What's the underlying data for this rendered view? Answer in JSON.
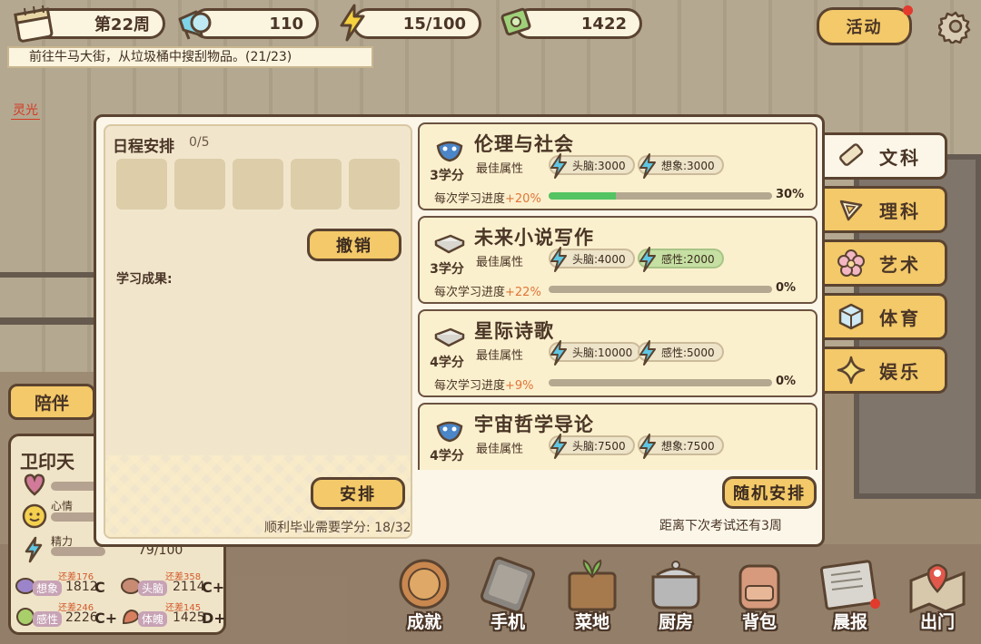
{
  "hud": {
    "week": "第22周",
    "announce_value": "110",
    "energy": "15/100",
    "money": "1422",
    "quest": "前往牛马大街，从垃圾桶中搜刮物品。(21/23)",
    "activity_label": "活动",
    "lingguang": "灵光"
  },
  "character": {
    "accompany_label": "陪伴",
    "name": "卫印天",
    "mood_label": "心情",
    "energy_label": "精力",
    "energy_value": "79/100",
    "attributes": [
      {
        "label": "想象",
        "value": "1812",
        "diff": "还差176",
        "grade": "C"
      },
      {
        "label": "头脑",
        "value": "2114",
        "diff": "还差358",
        "grade": "C+"
      },
      {
        "label": "感性",
        "value": "2226",
        "diff": "还差246",
        "grade": "C+"
      },
      {
        "label": "体魄",
        "value": "1425",
        "diff": "还差145",
        "grade": "D+"
      }
    ]
  },
  "schedule": {
    "title": "日程安排",
    "count": "0/5",
    "cancel_label": "撤销",
    "result_label": "学习成果:",
    "arrange_label": "安排",
    "credits_text": "顺利毕业需要学分: 18/32"
  },
  "courses": [
    {
      "name": "伦理与社会",
      "credit": "3学分",
      "best_label": "最佳属性",
      "attrs": [
        {
          "text": "头脑:3000",
          "met": false
        },
        {
          "text": "想象:3000",
          "met": false
        }
      ],
      "progress_prefix": "每次学习进度",
      "progress_gain": "+20%",
      "progress_value": "30%",
      "progress": 0.3,
      "icon": "mask-icon"
    },
    {
      "name": "未来小说写作",
      "credit": "3学分",
      "best_label": "最佳属性",
      "attrs": [
        {
          "text": "头脑:4000",
          "met": false
        },
        {
          "text": "感性:2000",
          "met": true
        }
      ],
      "progress_prefix": "每次学习进度",
      "progress_gain": "+22%",
      "progress_value": "0%",
      "progress": 0.0,
      "icon": "book-icon"
    },
    {
      "name": "星际诗歌",
      "credit": "4学分",
      "best_label": "最佳属性",
      "attrs": [
        {
          "text": "头脑:10000",
          "met": false
        },
        {
          "text": "感性:5000",
          "met": false
        }
      ],
      "progress_prefix": "每次学习进度",
      "progress_gain": "+9%",
      "progress_value": "0%",
      "progress": 0.0,
      "icon": "book-icon"
    },
    {
      "name": "宇宙哲学导论",
      "credit": "4学分",
      "best_label": "最佳属性",
      "attrs": [
        {
          "text": "头脑:7500",
          "met": false
        },
        {
          "text": "想象:7500",
          "met": false
        }
      ],
      "progress_prefix": "",
      "progress_gain": "",
      "progress_value": "",
      "progress": 0.0,
      "icon": "mask-icon"
    }
  ],
  "random_label": "随机安排",
  "exam_text": "距离下次考试还有3周",
  "tabs": [
    {
      "label": "文科",
      "icon": "scroll-icon",
      "active": true
    },
    {
      "label": "理科",
      "icon": "ruler-icon",
      "active": false
    },
    {
      "label": "艺术",
      "icon": "flower-icon",
      "active": false
    },
    {
      "label": "体育",
      "icon": "cube-icon",
      "active": false
    },
    {
      "label": "娱乐",
      "icon": "star-icon",
      "active": false
    }
  ],
  "nav": [
    {
      "label": "成就",
      "icon": "medal-icon"
    },
    {
      "label": "手机",
      "icon": "phone-icon"
    },
    {
      "label": "菜地",
      "icon": "sprout-icon"
    },
    {
      "label": "厨房",
      "icon": "pot-icon"
    },
    {
      "label": "背包",
      "icon": "backpack-icon"
    },
    {
      "label": "晨报",
      "icon": "newspaper-icon"
    },
    {
      "label": "出门",
      "icon": "map-pin-icon"
    }
  ],
  "colors": {
    "accent": "#f3c969",
    "progress_green": "#53c461",
    "outline": "#5a4330",
    "highlight": "#e0753a"
  }
}
